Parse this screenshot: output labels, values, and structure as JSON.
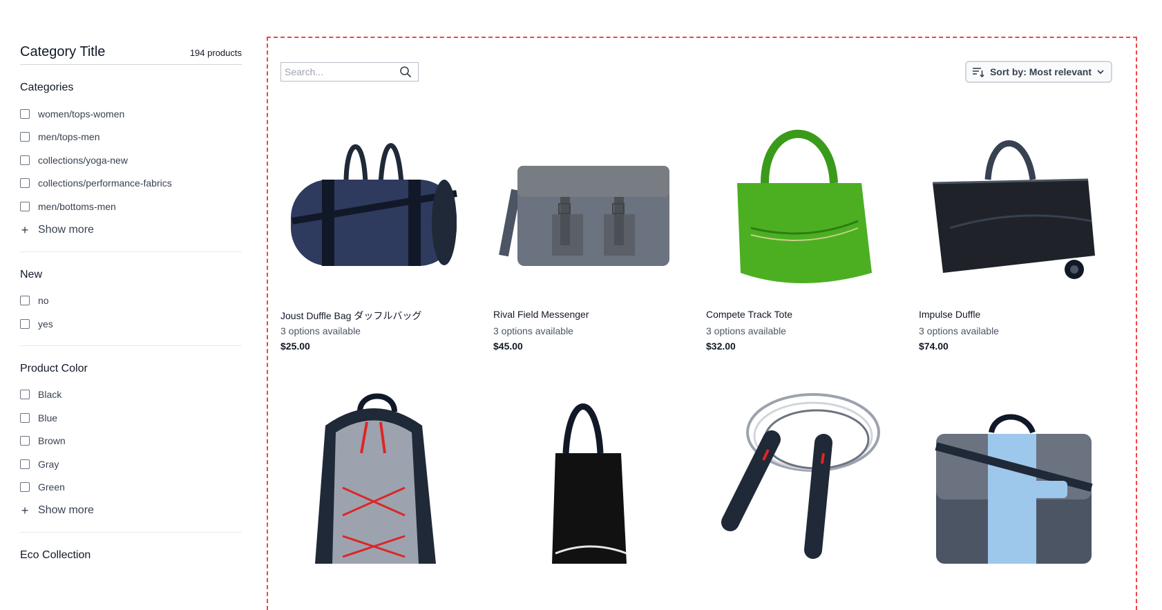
{
  "sidebar": {
    "title": "Category Title",
    "count": "194 products",
    "sections": [
      {
        "title": "Categories",
        "options": [
          "women/tops-women",
          "men/tops-men",
          "collections/yoga-new",
          "collections/performance-fabrics",
          "men/bottoms-men"
        ],
        "show_more": "Show more"
      },
      {
        "title": "New",
        "options": [
          "no",
          "yes"
        ]
      },
      {
        "title": "Product Color",
        "options": [
          "Black",
          "Blue",
          "Brown",
          "Gray",
          "Green"
        ],
        "show_more": "Show more"
      },
      {
        "title": "Eco Collection",
        "options": []
      }
    ]
  },
  "main": {
    "search_placeholder": "Search...",
    "sort_label": "Sort by: Most relevant",
    "products": [
      {
        "name": "Joust Duffle Bag ダッフルバッグ",
        "options": "3 options available",
        "price": "$25.00",
        "image": "navy-duffle-bag"
      },
      {
        "name": "Rival Field Messenger",
        "options": "3 options available",
        "price": "$45.00",
        "image": "gray-messenger-bag"
      },
      {
        "name": "Compete Track Tote",
        "options": "3 options available",
        "price": "$32.00",
        "image": "green-tote-bag"
      },
      {
        "name": "Impulse Duffle",
        "options": "3 options available",
        "price": "$74.00",
        "image": "black-rolling-duffle"
      },
      {
        "name": "",
        "options": "",
        "price": "",
        "image": "gray-backpack"
      },
      {
        "name": "",
        "options": "",
        "price": "",
        "image": "black-tote"
      },
      {
        "name": "",
        "options": "",
        "price": "",
        "image": "jump-rope"
      },
      {
        "name": "",
        "options": "",
        "price": "",
        "image": "blue-messenger-bag"
      }
    ]
  },
  "colors": {
    "dashed_border": "#ef4444",
    "text_primary": "#111827",
    "text_secondary": "#4b5563"
  }
}
